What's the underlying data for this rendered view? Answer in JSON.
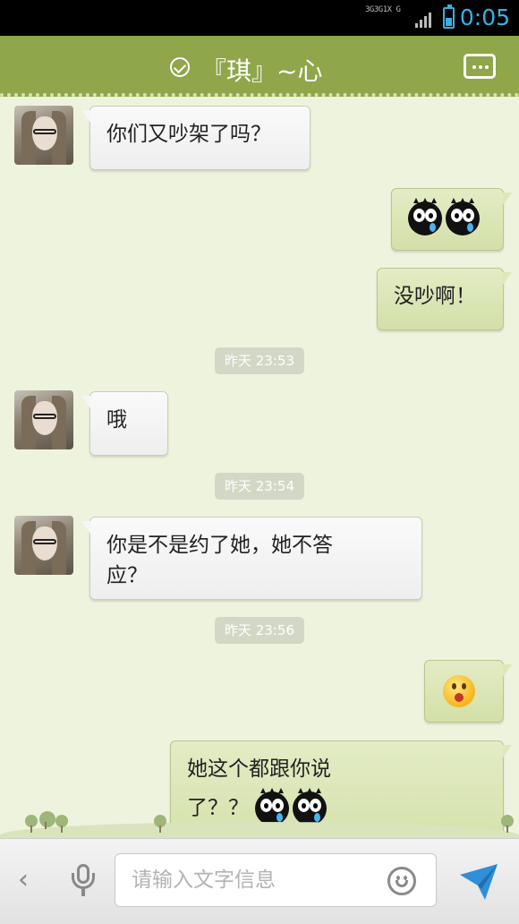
{
  "status_bar": {
    "time": "0:05",
    "network_labels": [
      "3G",
      "3G",
      "1X",
      "G"
    ],
    "battery_icon": "battery-icon",
    "signal_icon": "signal-icon"
  },
  "header": {
    "title": "『琪』~心",
    "check_icon": "check-circle-icon",
    "more_icon": "more-dots-icon"
  },
  "messages": [
    {
      "side": "left",
      "text": "你们又吵架了吗？"
    },
    {
      "side": "right",
      "emoji": [
        "crying-black-emoji",
        "crying-black-emoji"
      ]
    },
    {
      "side": "right",
      "text": "没吵啊！"
    },
    {
      "type": "timestamp",
      "text": "昨天 23:53"
    },
    {
      "side": "left",
      "text": "哦"
    },
    {
      "type": "timestamp",
      "text": "昨天 23:54"
    },
    {
      "side": "left",
      "text_line1": "你是不是约了她，她不答",
      "text_line2": "应？"
    },
    {
      "type": "timestamp",
      "text": "昨天 23:56"
    },
    {
      "side": "right",
      "emoji": [
        "surprised-yellow-emoji"
      ]
    },
    {
      "side": "right",
      "text_line1": "她这个都跟你说",
      "text_line2": "了？？",
      "emoji": [
        "crying-black-emoji",
        "crying-black-emoji"
      ]
    }
  ],
  "input_bar": {
    "placeholder": "请输入文字信息",
    "back_icon": "chevron-left-icon",
    "voice_icon": "microphone-icon",
    "emoji_icon": "smiley-icon",
    "send_icon": "send-icon"
  },
  "colors": {
    "header_bg": "#8fa64a",
    "chat_bg": "#eef3dd",
    "time_text": "#37b0e8"
  }
}
